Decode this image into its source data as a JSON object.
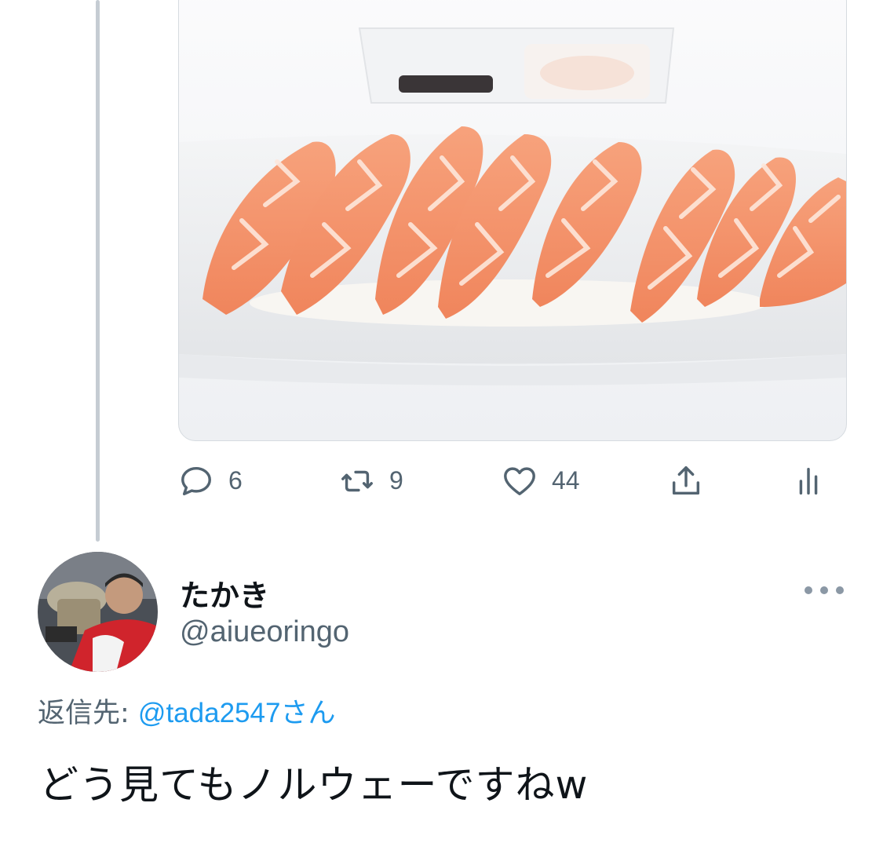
{
  "previous_tweet": {
    "media_alt": "",
    "actions": {
      "reply_count": "6",
      "retweet_count": "9",
      "like_count": "44"
    }
  },
  "reply_tweet": {
    "display_name": "たかき",
    "handle": "@aiueoringo",
    "replying_label": "返信先: ",
    "replying_to": "@tada2547",
    "replying_suffix": "さん",
    "text": "どう見てもノルウェーですねw"
  },
  "icons": {
    "reply": "reply-icon",
    "retweet": "retweet-icon",
    "like": "heart-icon",
    "share": "share-icon",
    "analytics": "analytics-icon",
    "more": "more-icon"
  },
  "colors": {
    "accent": "#1d9bf0",
    "secondary_text": "#536471",
    "primary_text": "#0f1419",
    "salmon": "#f59b73"
  }
}
